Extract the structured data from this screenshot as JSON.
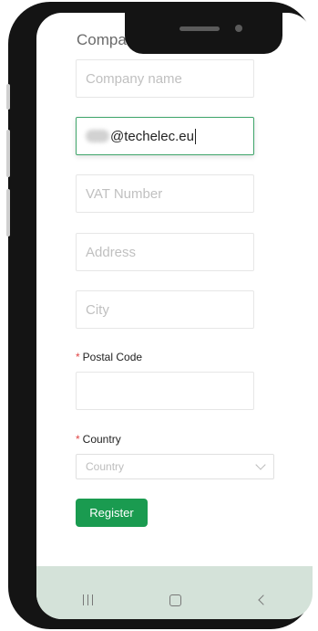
{
  "form": {
    "section_title": "Company",
    "company_name_placeholder": "Company name",
    "email_value": "@techelec.eu",
    "vat_placeholder": "VAT Number",
    "address_placeholder": "Address",
    "city_placeholder": "City",
    "postal_required_mark": "*",
    "postal_label": "Postal Code",
    "country_required_mark": "*",
    "country_label": "Country",
    "country_select_value": "Country",
    "register_label": "Register"
  },
  "colors": {
    "primary_button": "#1a9b50",
    "focus_border": "#3fa56a",
    "required_mark": "#e04545",
    "nav_bar": "#d4e2d9"
  },
  "navbar": {
    "icons": [
      "recent-apps-icon",
      "home-icon",
      "back-icon"
    ]
  }
}
